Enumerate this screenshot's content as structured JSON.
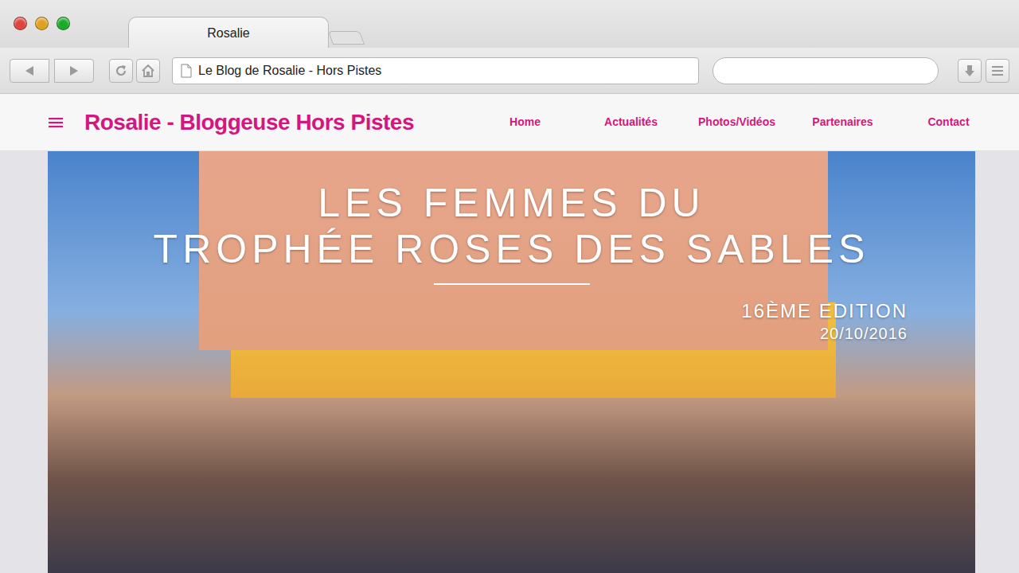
{
  "window": {
    "controls": [
      {
        "kind": "close",
        "color": "#e0443e"
      },
      {
        "kind": "minimize",
        "color": "#dea123"
      },
      {
        "kind": "maximize",
        "color": "#1aab29"
      }
    ]
  },
  "tabs": [
    {
      "label": "Rosalie",
      "selected": true
    }
  ],
  "address_bar": {
    "value": "Le Blog de Rosalie - Hors Pistes"
  },
  "site": {
    "title": "Rosalie - Bloggeuse Hors Pistes",
    "nav": [
      {
        "label": "Home"
      },
      {
        "label": "Actualités"
      },
      {
        "label": "Photos/Vidéos"
      },
      {
        "label": "Partenaires"
      },
      {
        "label": "Contact"
      }
    ]
  },
  "hero": {
    "title_lines": [
      "LES FEMMES DU",
      "TROPHÉE ROSES DES SABLES"
    ],
    "edition": "16ÈME EDITION",
    "date": "20/10/2016"
  }
}
